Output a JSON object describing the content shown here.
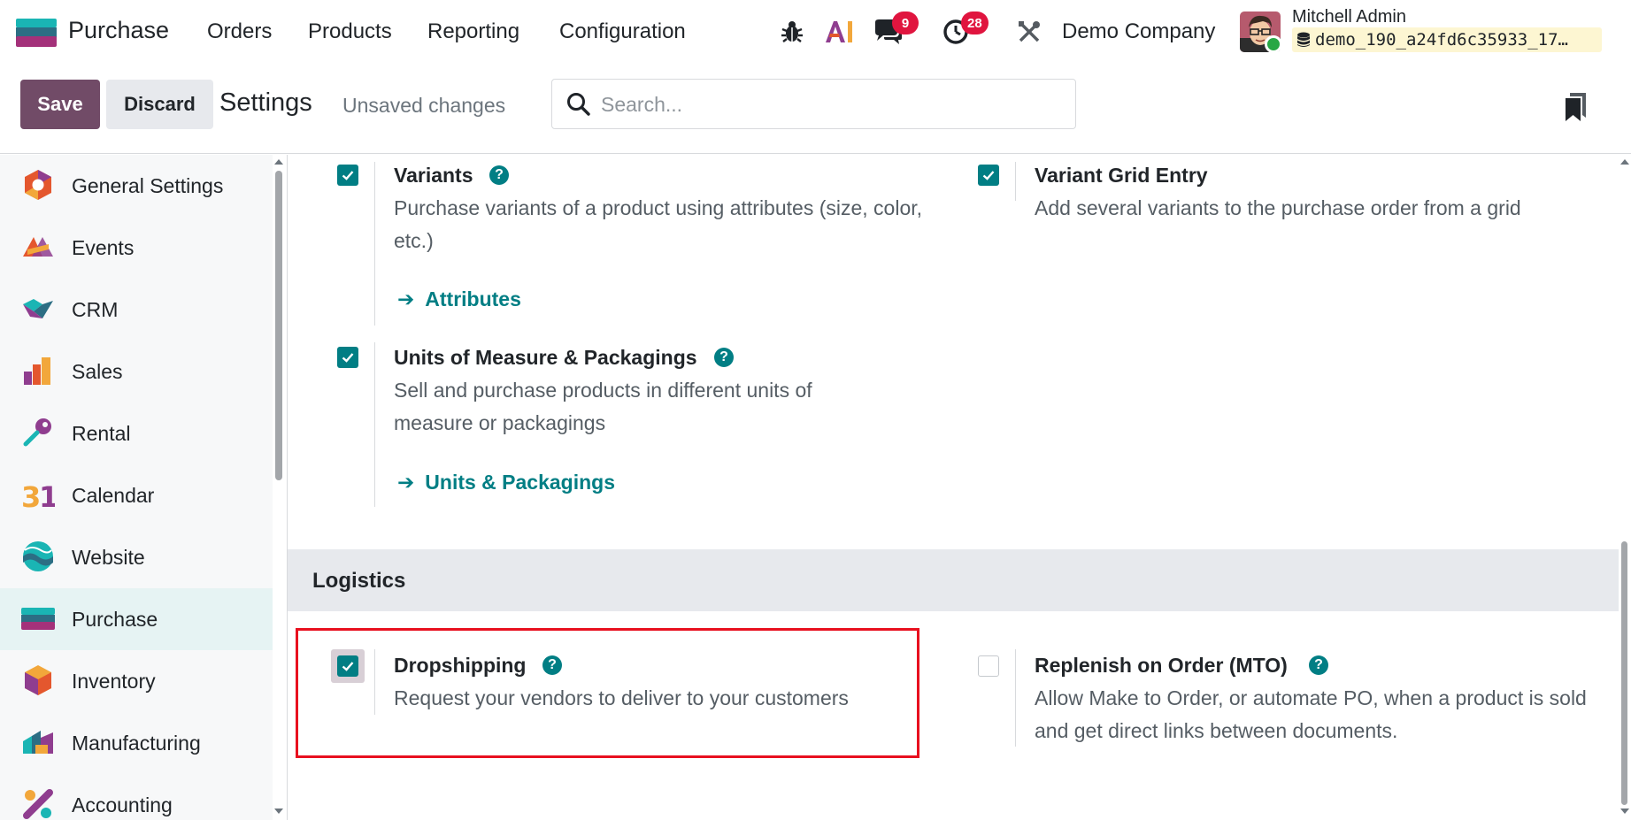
{
  "navbar": {
    "app_name": "Purchase",
    "menu": [
      "Orders",
      "Products",
      "Reporting",
      "Configuration"
    ],
    "icons": [
      "bug-icon",
      "ai-icon",
      "chat-icon",
      "activity-clock-icon",
      "tools-icon"
    ],
    "messages_badge": "9",
    "activities_badge": "28",
    "company": "Demo Company",
    "user_name": "Mitchell Admin",
    "database": "demo_190_a24fd6c35933_17…",
    "accent": "#714b67"
  },
  "control_panel": {
    "save_label": "Save",
    "discard_label": "Discard",
    "title": "Settings",
    "unsaved": "Unsaved changes",
    "search_placeholder": "Search..."
  },
  "sidebar": {
    "items": [
      {
        "label": "General Settings",
        "icon": "general-settings-icon"
      },
      {
        "label": "Events",
        "icon": "events-icon"
      },
      {
        "label": "CRM",
        "icon": "crm-icon"
      },
      {
        "label": "Sales",
        "icon": "sales-icon"
      },
      {
        "label": "Rental",
        "icon": "rental-icon"
      },
      {
        "label": "Calendar",
        "icon": "calendar-icon"
      },
      {
        "label": "Website",
        "icon": "website-icon"
      },
      {
        "label": "Purchase",
        "icon": "purchase-icon",
        "active": true
      },
      {
        "label": "Inventory",
        "icon": "inventory-icon"
      },
      {
        "label": "Manufacturing",
        "icon": "manufacturing-icon"
      },
      {
        "label": "Accounting",
        "icon": "accounting-icon"
      }
    ]
  },
  "settings": {
    "variants": {
      "title": "Variants",
      "description": "Purchase variants of a product using attributes (size, color, etc.)",
      "link": "Attributes",
      "checked": true
    },
    "variant_grid": {
      "title": "Variant Grid Entry",
      "description": "Add several variants to the purchase order from a grid",
      "checked": true
    },
    "uom": {
      "title": "Units of Measure & Packagings",
      "description": "Sell and purchase products in different units of measure or packagings",
      "link": "Units & Packagings",
      "checked": true
    },
    "logistics_title": "Logistics",
    "dropshipping": {
      "title": "Dropshipping",
      "description": "Request your vendors to deliver to your customers",
      "checked": true
    },
    "mto": {
      "title": "Replenish on Order (MTO)",
      "description": "Allow Make to Order, or automate PO, when a product is sold and get direct links between documents.",
      "checked": false
    }
  }
}
